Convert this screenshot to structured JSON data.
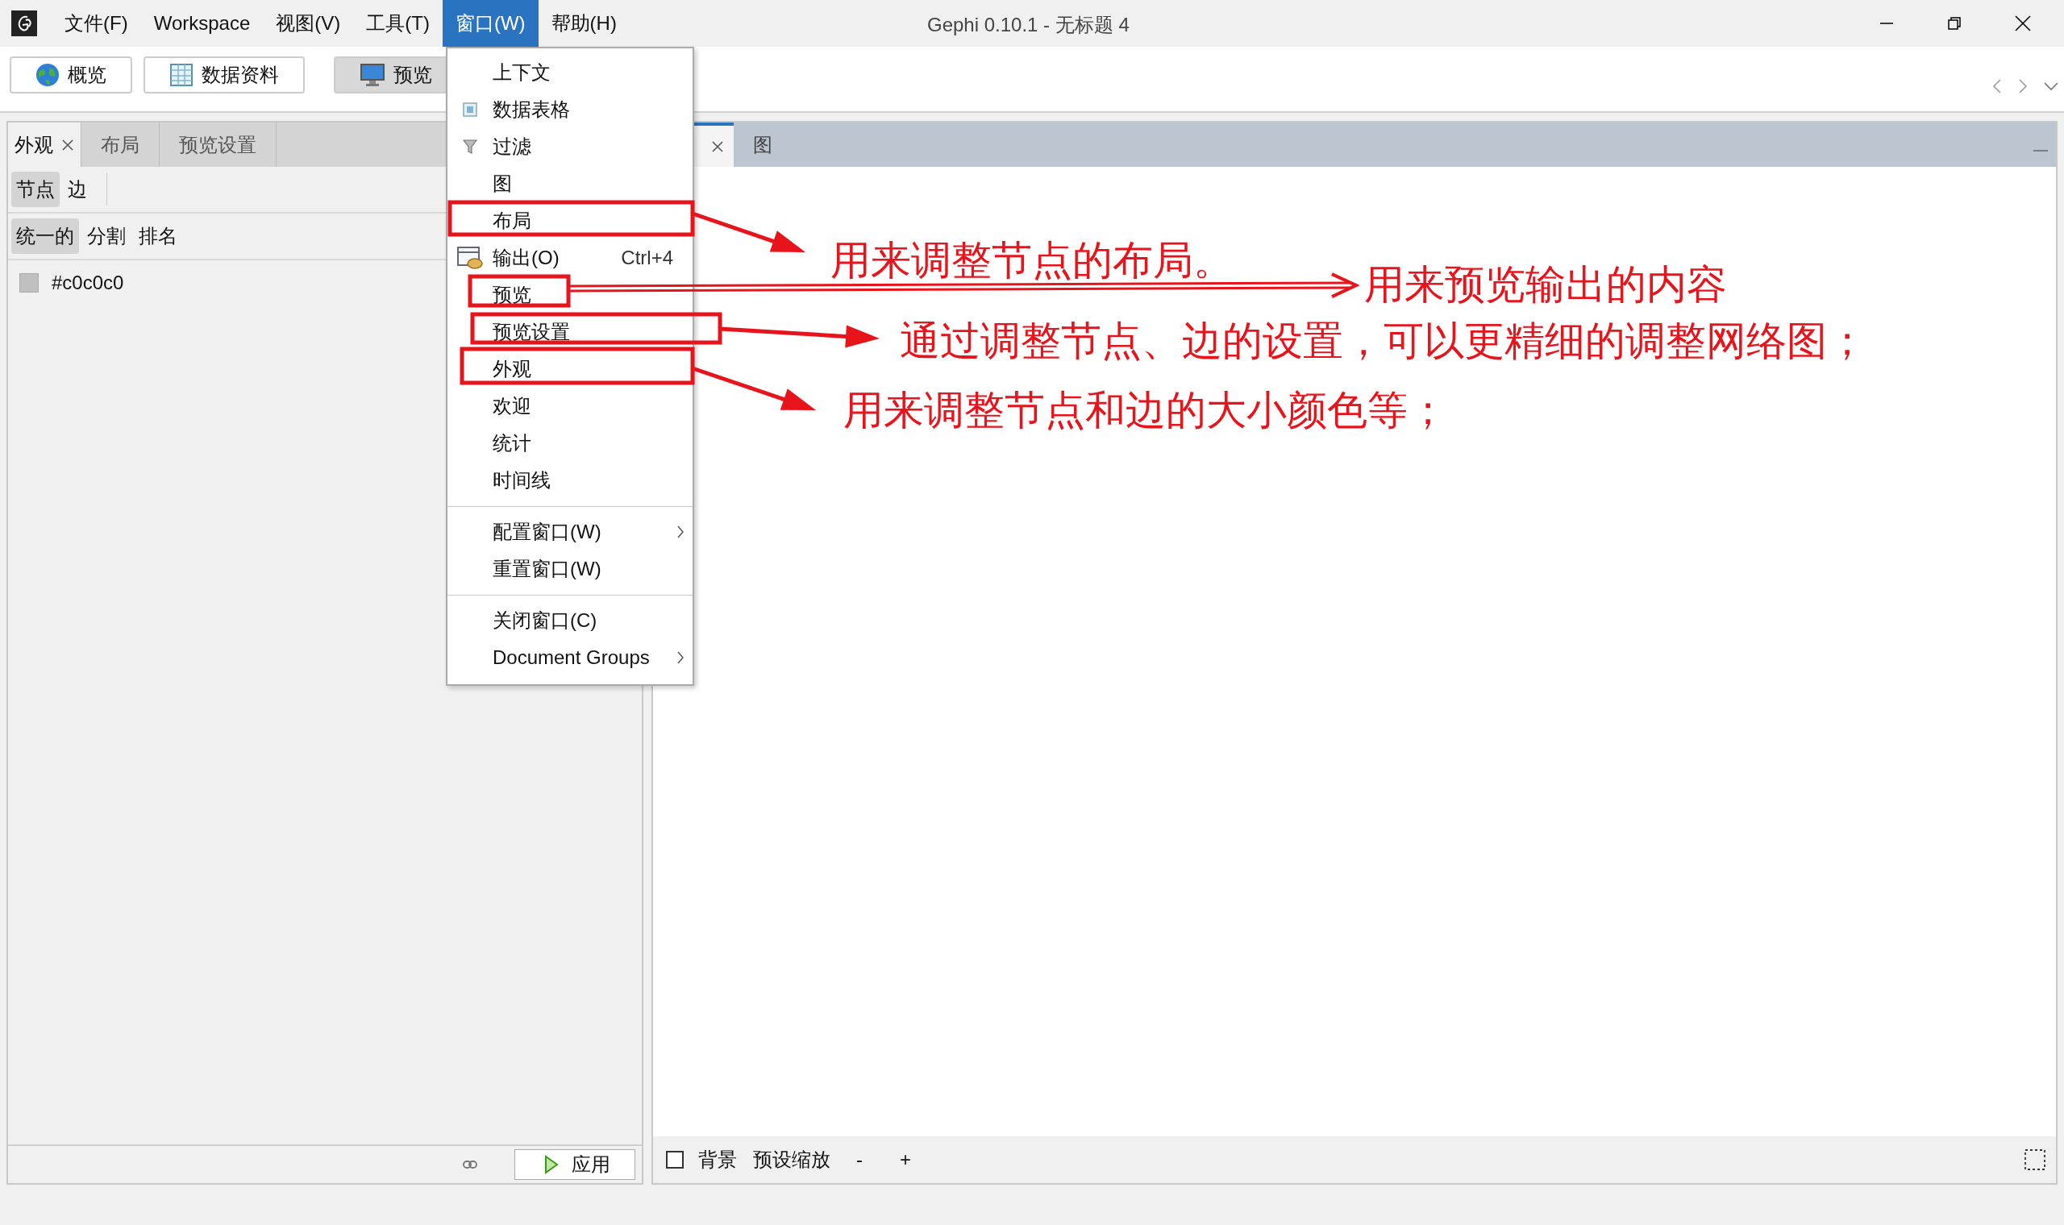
{
  "window": {
    "title": "Gephi 0.10.1 - 无标题 4"
  },
  "menu_bar": [
    {
      "label": "文件(F)",
      "selected": false
    },
    {
      "label": "Workspace",
      "selected": false
    },
    {
      "label": "视图(V)",
      "selected": false
    },
    {
      "label": "工具(T)",
      "selected": false
    },
    {
      "label": "窗口(W)",
      "selected": true
    },
    {
      "label": "帮助(H)",
      "selected": false
    }
  ],
  "toolbar": [
    {
      "label": "概览",
      "selected": false
    },
    {
      "label": "数据资料",
      "selected": false
    },
    {
      "label": "预览",
      "selected": true
    }
  ],
  "window_menu": [
    [
      {
        "label": "上下文"
      },
      {
        "label": "数据表格"
      },
      {
        "label": "过滤"
      },
      {
        "label": "图"
      },
      {
        "label": "布局"
      },
      {
        "label": "输出(O)",
        "shortcut": "Ctrl+4"
      },
      {
        "label": "预览"
      },
      {
        "label": "预览设置"
      },
      {
        "label": "外观"
      },
      {
        "label": "欢迎"
      },
      {
        "label": "统计"
      },
      {
        "label": "时间线"
      }
    ],
    [
      {
        "label": "配置窗口(W)",
        "submenu": true
      },
      {
        "label": "重置窗口(W)"
      }
    ],
    [
      {
        "label": "关闭窗口(C)"
      },
      {
        "label": "Document Groups",
        "submenu": true
      }
    ]
  ],
  "left_panel": {
    "tabs": [
      {
        "label": "外观",
        "selected": true,
        "closable": true
      },
      {
        "label": "布局",
        "selected": false
      },
      {
        "label": "预览设置",
        "selected": false
      }
    ],
    "element_tabs": [
      {
        "label": "节点",
        "selected": true
      },
      {
        "label": "边",
        "selected": false
      }
    ],
    "mode_tabs": [
      {
        "label": "统一的",
        "selected": true
      },
      {
        "label": "分割",
        "selected": false
      },
      {
        "label": "排名",
        "selected": false
      }
    ],
    "color": {
      "value": "#c0c0c0",
      "color": "#c0c0c0"
    },
    "apply_button": "应用"
  },
  "right_panel": {
    "tabs": [
      {
        "selected": true,
        "closable": true
      },
      {
        "label": "图",
        "selected": false
      }
    ],
    "background": {
      "label": "背景",
      "checked": false
    },
    "zoom_label": "预设缩放",
    "zoom_out": "-",
    "zoom_in": "+"
  },
  "annotations": [
    {
      "text": "用来调整节点的布局。"
    },
    {
      "text": "用来预览输出的内容"
    },
    {
      "text": "通过调整节点、边的设置，可以更精细的调整网络图；"
    },
    {
      "text": "用来调整节点和边的大小颜色等；"
    }
  ]
}
